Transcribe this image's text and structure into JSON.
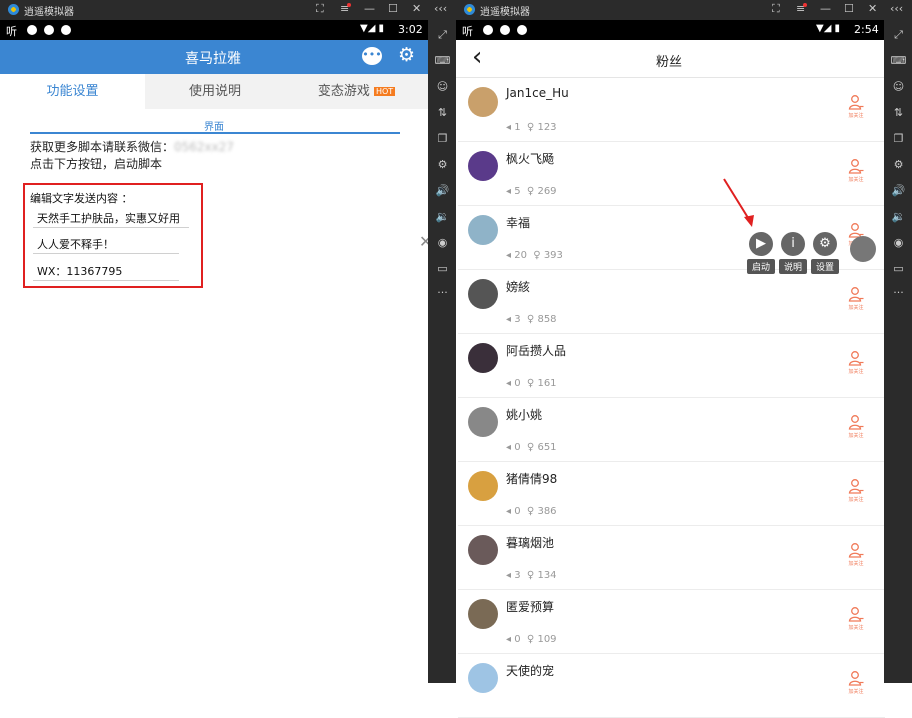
{
  "left_emulator": {
    "window_title": "逍遥模拟器",
    "window_buttons": [
      "⛶",
      "≡",
      "—",
      "☐",
      "✕"
    ],
    "collapse_label": "‹‹‹",
    "status": {
      "left_text": "听",
      "time": "3:02"
    },
    "app_title": "喜马拉雅",
    "tabs": [
      "功能设置",
      "使用说明",
      "变态游戏"
    ],
    "hot_badge": "HOT",
    "section_label": "界面",
    "info_line1": "获取更多脚本请联系微信：",
    "info_line1_blurred": "0562xx27",
    "info_line2": "点击下方按钮，启动脚本",
    "edit_label": "编辑文字发送内容 ：",
    "inputs": [
      "天然手工护肤品，实惠又好用",
      "人人爱不释手！",
      "WX：11367795"
    ]
  },
  "right_emulator": {
    "window_title": "逍遥模拟器",
    "window_buttons": [
      "⛶",
      "≡",
      "—",
      "☐",
      "✕"
    ],
    "collapse_label": "‹‹‹",
    "status": {
      "left_text": "听",
      "time": "2:54"
    },
    "page_title": "粉丝",
    "back_icon": "‹",
    "follow_label": "加关注",
    "fans": [
      {
        "name": "Jan1ce_Hu",
        "works": "1",
        "fans": "123",
        "avatar_color": "#c9a06b"
      },
      {
        "name": "枫火飞飏",
        "works": "5",
        "fans": "269",
        "avatar_color": "#5a3a8a"
      },
      {
        "name": "幸福",
        "works": "20",
        "fans": "393",
        "avatar_color": "#8fb3c8"
      },
      {
        "name": "嫎絯",
        "works": "3",
        "fans": "858",
        "avatar_color": "#555555"
      },
      {
        "name": "阿岳攒人品",
        "works": "0",
        "fans": "161",
        "avatar_color": "#3a2f3a"
      },
      {
        "name": "姚小姚",
        "works": "0",
        "fans": "651",
        "avatar_color": "#888888"
      },
      {
        "name": "猪倩倩98",
        "works": "0",
        "fans": "386",
        "avatar_color": "#d8a040"
      },
      {
        "name": "暮璃烟池",
        "works": "3",
        "fans": "134",
        "avatar_color": "#6a5a5a"
      },
      {
        "name": "匿爱预算",
        "works": "0",
        "fans": "109",
        "avatar_color": "#7a6a55"
      },
      {
        "name": "天使的宠",
        "works": "",
        "fans": "",
        "avatar_color": "#9ec4e4"
      }
    ],
    "float_buttons": [
      {
        "label": "启动",
        "icon": "▶"
      },
      {
        "label": "说明",
        "icon": "i"
      },
      {
        "label": "设置",
        "icon": "⚙"
      }
    ],
    "accent_color": "#f07a59"
  }
}
